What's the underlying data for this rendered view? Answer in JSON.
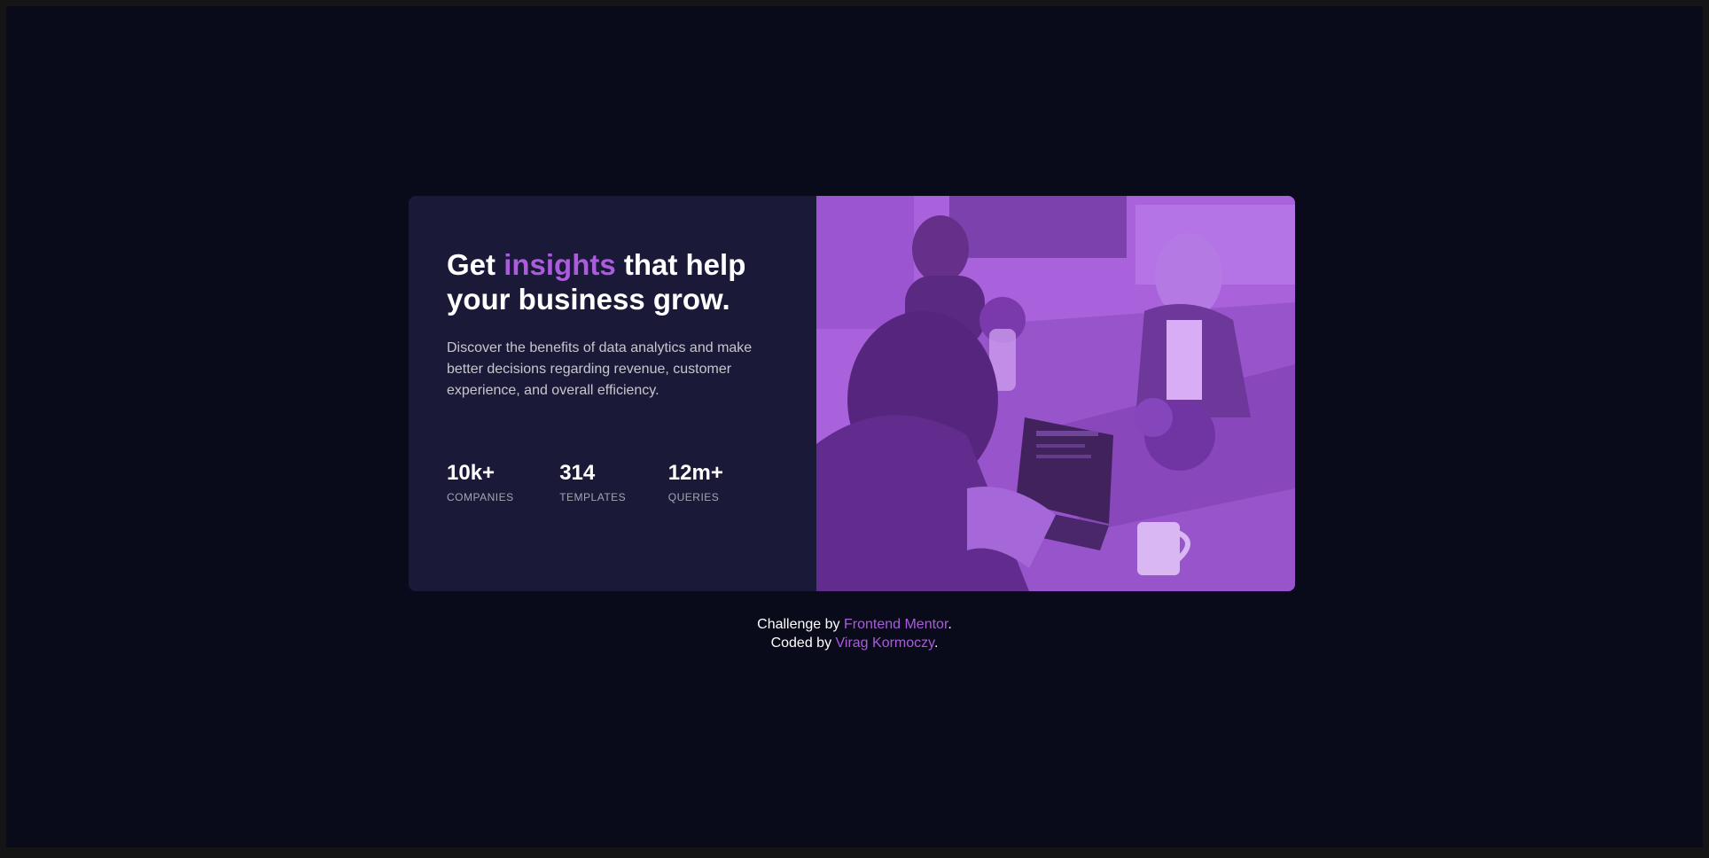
{
  "card": {
    "headline_prefix": "Get ",
    "headline_accent": "insights",
    "headline_suffix": " that help your business grow.",
    "description": "Discover the benefits of data analytics and make better decisions regarding revenue, customer experience, and overall efficiency.",
    "stats": [
      {
        "value": "10k+",
        "label": "COMPANIES"
      },
      {
        "value": "314",
        "label": "TEMPLATES"
      },
      {
        "value": "12m+",
        "label": "QUERIES"
      }
    ]
  },
  "footer": {
    "challenge_prefix": "Challenge by ",
    "challenge_link": "Frontend Mentor",
    "challenge_suffix": ".",
    "coded_prefix": "Coded by ",
    "coded_link": "Virag Kormoczy",
    "coded_suffix": "."
  },
  "colors": {
    "page_background": "#090b1a",
    "card_background": "#1b1938",
    "accent": "#aa5cdb",
    "image_tint": "#aa5cdb"
  }
}
